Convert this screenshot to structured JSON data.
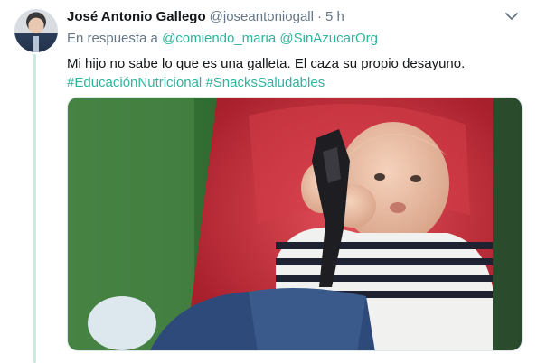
{
  "tweet": {
    "author_name": "José Antonio Gallego",
    "author_handle": "@joseantoniogall",
    "separator": "·",
    "time": "5 h",
    "reply_prefix": "En respuesta a",
    "reply_mentions": [
      "@comiendo_maria",
      "@SinAzucarOrg"
    ],
    "text": "Mi hijo no sabe lo que es una galleta. El caza su propio desayuno.",
    "hashtags": [
      "#EducaciónNutricional",
      "#SnacksSaludables"
    ]
  },
  "icons": {
    "menu": "chevron-down-icon",
    "avatar": "profile-avatar"
  },
  "colors": {
    "accent": "#2fb49c",
    "muted": "#657786",
    "thread_line": "#c8ece0"
  }
}
